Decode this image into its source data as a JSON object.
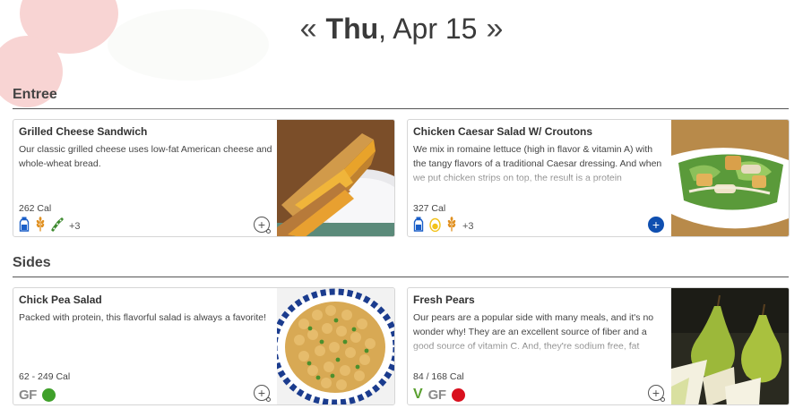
{
  "header": {
    "prev_label": "«",
    "day": "Thu",
    "date_rest": ", Apr 15",
    "next_label": "»"
  },
  "sections": [
    {
      "title": "Entree",
      "items": [
        {
          "name": "Grilled Cheese Sandwich",
          "description": "Our classic grilled cheese uses low-fat American cheese and whole-wheat bread.",
          "calories": "262 Cal",
          "icons": [
            "milk-bottle-icon",
            "wheat-icon",
            "soy-icon"
          ],
          "more_label": "+3",
          "add_state": "outline"
        },
        {
          "name": "Chicken Caesar Salad W/ Croutons",
          "description": "We mix in romaine lettuce (high in flavor & vitamin A) with the tangy flavors of a traditional Caesar dressing. And when we put chicken strips on top, the result is a protein",
          "calories": "327 Cal",
          "icons": [
            "milk-bottle-icon",
            "egg-icon",
            "wheat-icon"
          ],
          "more_label": "+3",
          "add_state": "filled"
        }
      ]
    },
    {
      "title": "Sides",
      "items": [
        {
          "name": "Chick Pea Salad",
          "description": "Packed with protein, this flavorful salad is always a favorite!",
          "calories": "62 - 249 Cal",
          "gf_label": "GF",
          "dot_color": "#3fa02a",
          "add_state": "outline"
        },
        {
          "name": "Fresh Pears",
          "description": "Our pears are a popular side with many meals, and it's no wonder why! They are an excellent source of fiber and a good source of vitamin C. And, they're sodium free, fat",
          "calories": "84 / 168 Cal",
          "veg_label": "V",
          "gf_label": "GF",
          "dot_color": "#d9101e",
          "add_state": "outline"
        }
      ]
    }
  ],
  "colors": {
    "accent_blue": "#0f4fb0",
    "allergen_blue": "#1a5fc8",
    "allergen_orange": "#e09020",
    "allergen_green": "#3d8a2e",
    "egg_yellow": "#f2c21a"
  }
}
